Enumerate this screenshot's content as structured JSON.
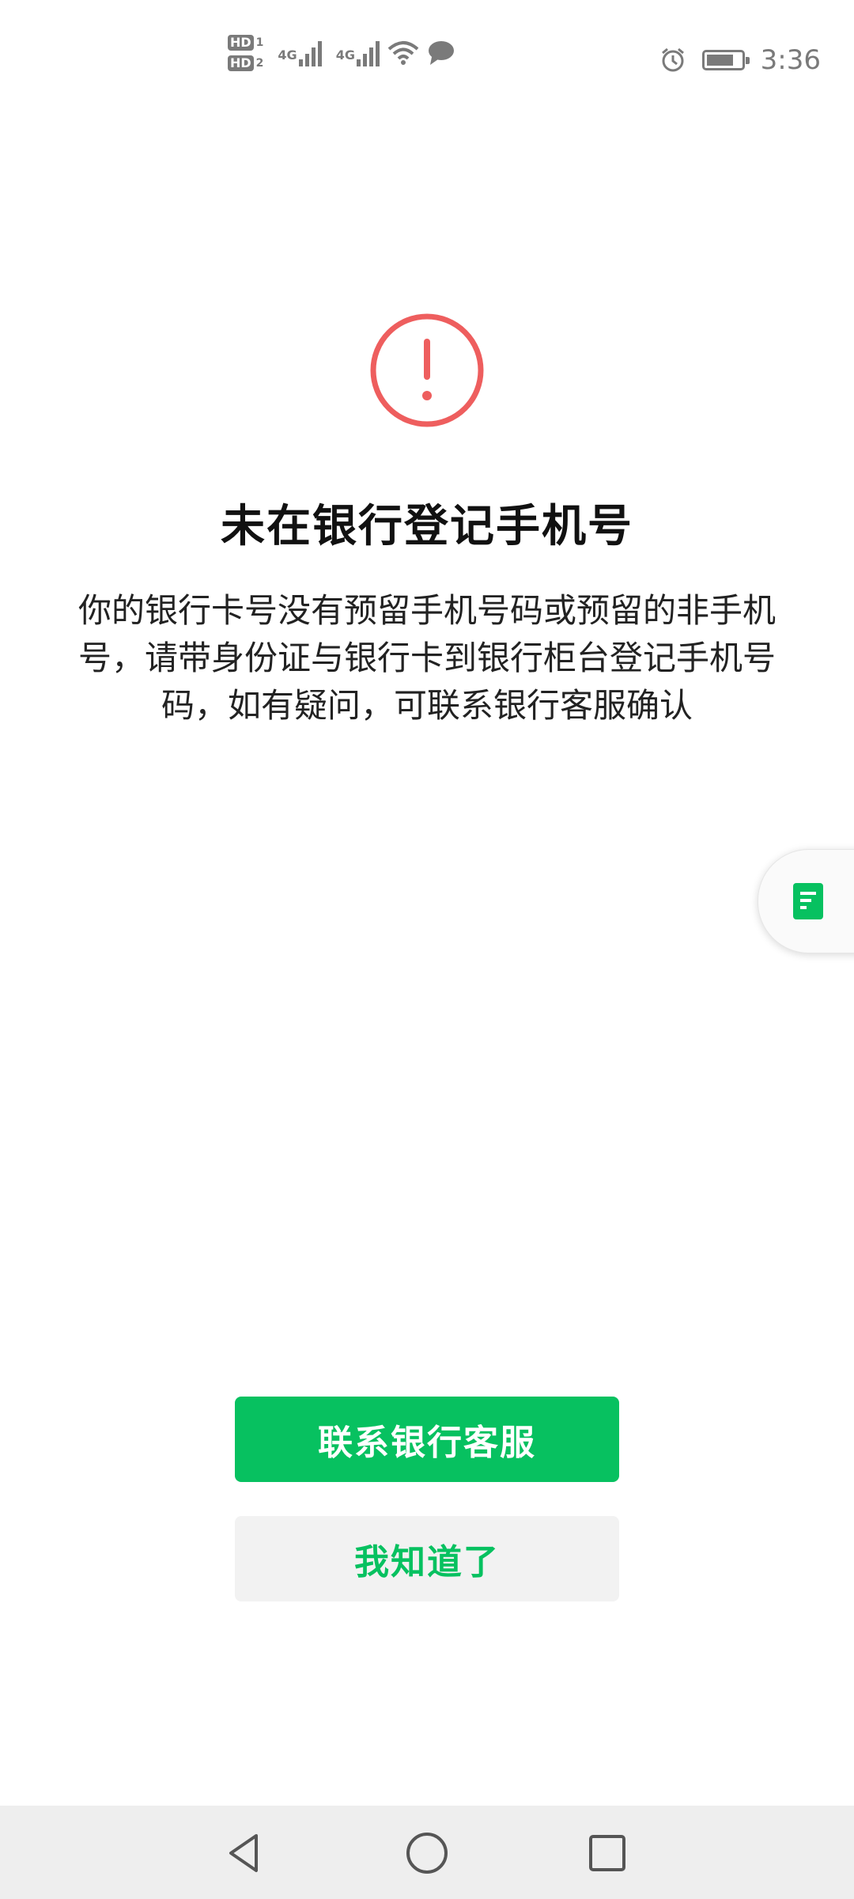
{
  "status_bar": {
    "hd1": "HD",
    "hd1_num": "1",
    "hd2": "HD",
    "hd2_num": "2",
    "net1": "4G",
    "net2": "4G",
    "time": "3:36",
    "icons": [
      "signal-icon",
      "wifi-icon",
      "message-icon",
      "alarm-icon",
      "battery-icon"
    ],
    "battery_level": 0.8
  },
  "dialog": {
    "icon": "alert-circle-icon",
    "title": "未在银行登记手机号",
    "description": "你的银行卡号没有预留手机号码或预留的非手机号，请带身份证与银行卡到银行柜台登记手机号码，如有疑问，可联系银行客服确认"
  },
  "side_tab": {
    "icon": "document-icon"
  },
  "buttons": {
    "contact_bank": "联系银行客服",
    "got_it": "我知道了"
  },
  "colors": {
    "accent": "#07c160",
    "alert": "#ee5e5e",
    "secondary_bg": "#f2f2f2",
    "nav_bg": "#eeeeee"
  },
  "nav_bar": {
    "icons": [
      "back-icon",
      "home-icon",
      "recent-apps-icon"
    ]
  }
}
